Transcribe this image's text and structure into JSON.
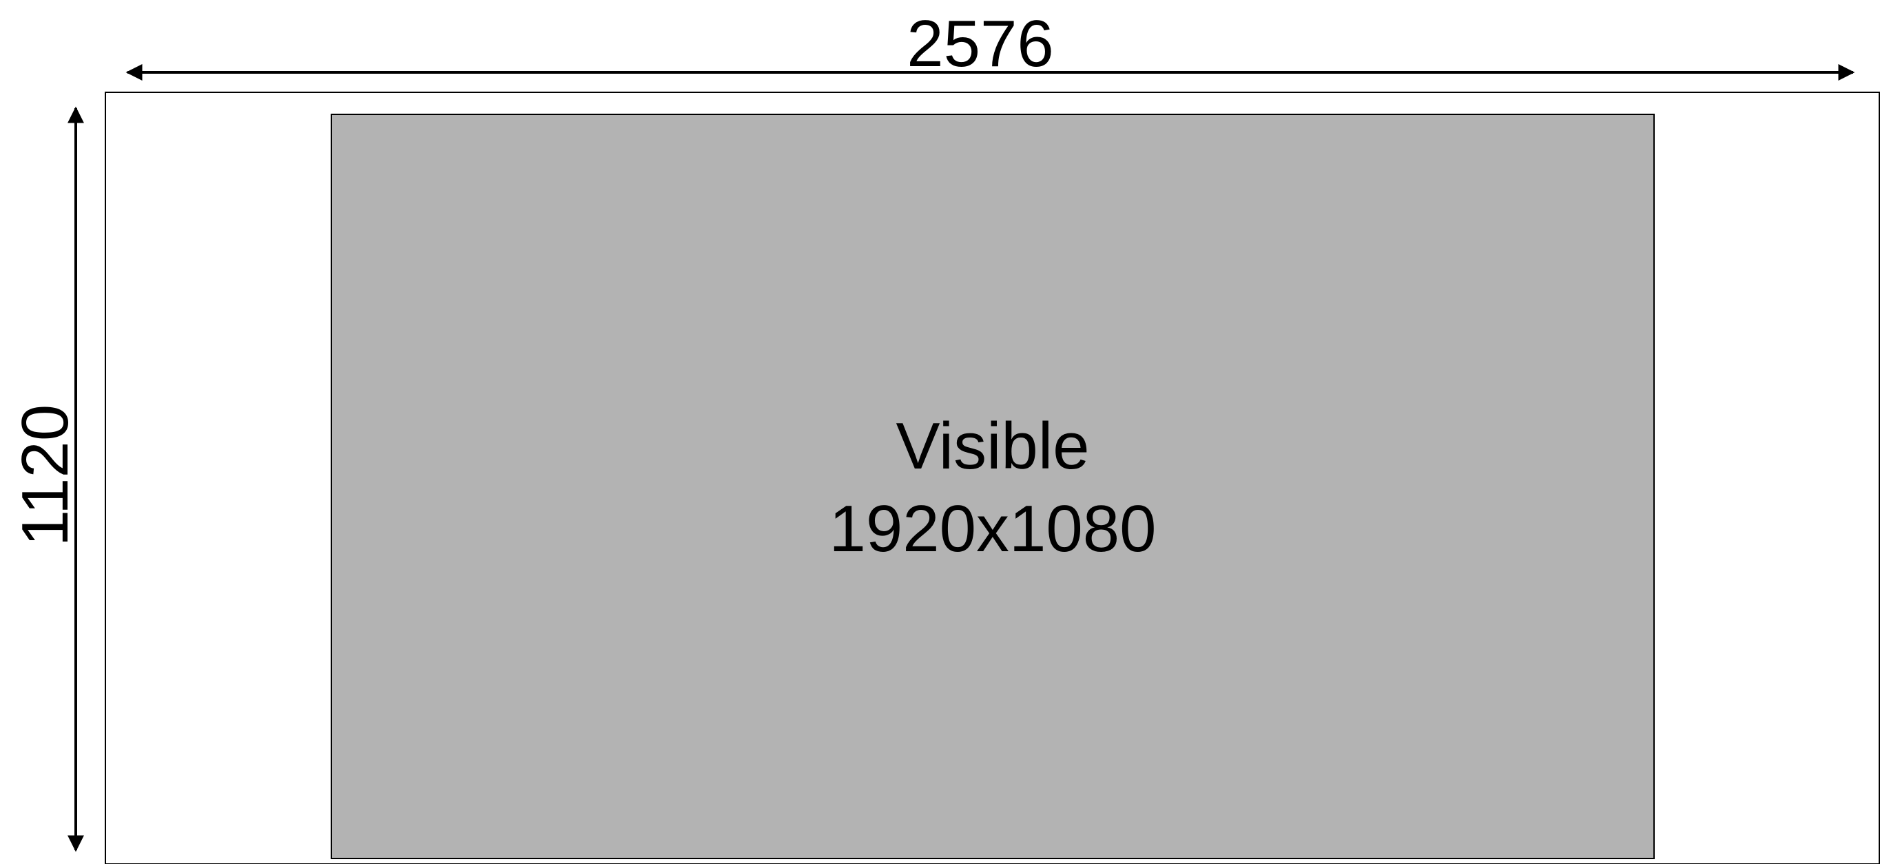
{
  "dimensions": {
    "width_label": "2576",
    "height_label": "1120"
  },
  "visible_area": {
    "line1": "Visible",
    "line2": "1920x1080"
  },
  "colors": {
    "outer_fill": "#ffffff",
    "outer_stroke": "#000000",
    "visible_fill": "#b3b3b3",
    "visible_stroke": "#000000",
    "arrow": "#000000",
    "text": "#000000"
  }
}
